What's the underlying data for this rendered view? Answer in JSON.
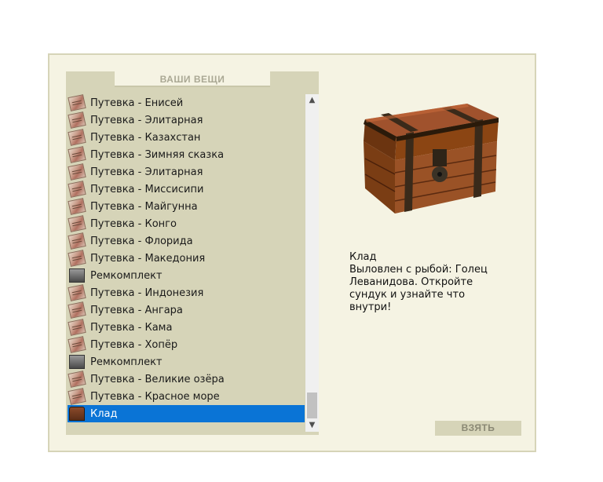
{
  "inventory": {
    "tab_title": "ВАШИ ВЕЩИ",
    "items": [
      {
        "label": "Путевка - Енисей",
        "icon": "ticket-icon"
      },
      {
        "label": "Путевка - Элитарная",
        "icon": "ticket-icon"
      },
      {
        "label": "Путевка - Казахстан",
        "icon": "ticket-icon"
      },
      {
        "label": "Путевка - Зимняя сказка",
        "icon": "ticket-icon"
      },
      {
        "label": "Путевка - Элитарная",
        "icon": "ticket-icon"
      },
      {
        "label": "Путевка - Миссисипи",
        "icon": "ticket-icon"
      },
      {
        "label": "Путевка - Майгунна",
        "icon": "ticket-icon"
      },
      {
        "label": "Путевка - Конго",
        "icon": "ticket-icon"
      },
      {
        "label": "Путевка - Флорида",
        "icon": "ticket-icon"
      },
      {
        "label": "Путевка - Македония",
        "icon": "ticket-icon"
      },
      {
        "label": "Ремкомплект",
        "icon": "repair-kit-icon"
      },
      {
        "label": "Путевка - Индонезия",
        "icon": "ticket-icon"
      },
      {
        "label": "Путевка - Ангара",
        "icon": "ticket-icon"
      },
      {
        "label": "Путевка - Кама",
        "icon": "ticket-icon"
      },
      {
        "label": "Путевка - Хопёр",
        "icon": "ticket-icon"
      },
      {
        "label": "Ремкомплект",
        "icon": "repair-kit-icon"
      },
      {
        "label": "Путевка - Великие озёра",
        "icon": "ticket-icon"
      },
      {
        "label": "Путевка - Красное море",
        "icon": "ticket-icon"
      },
      {
        "label": "Клад",
        "icon": "treasure-chest-icon",
        "selected": true
      }
    ]
  },
  "details": {
    "name": "Клад",
    "description_lines": [
      "Выловлен с рыбой: Голец",
      "Леванидова. Откройте",
      "сундук и узнайте что",
      "внутри!"
    ],
    "image_icon": "treasure-chest-image"
  },
  "actions": {
    "take_label": "ВЗЯТЬ"
  },
  "colors": {
    "panel": "#d6d4b8",
    "background": "#f5f3e3",
    "selection": "#0a74d6"
  }
}
